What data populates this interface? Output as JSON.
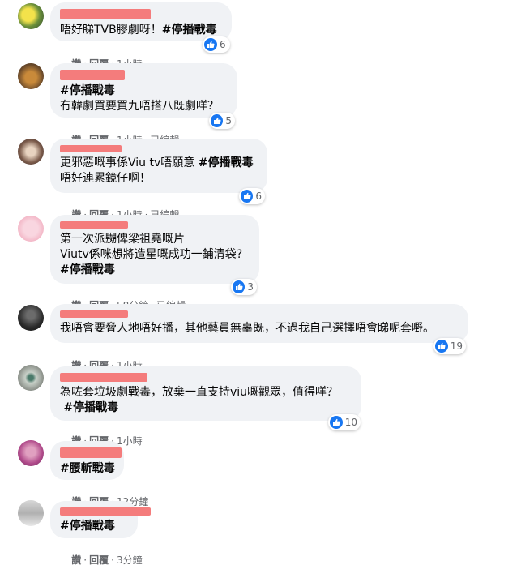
{
  "comments": [
    {
      "lines": [
        [
          "唔好睇TVB膠劇呀！",
          "#停播戰毒"
        ]
      ],
      "likes": "6",
      "actions": {
        "read": "讚",
        "reply": "回覆",
        "time": "1小時",
        "edited": ""
      }
    },
    {
      "lines": [
        [
          "",
          "#停播戰毒"
        ],
        [
          "冇韓劇買要買九唔搭八既劇咩？",
          ""
        ]
      ],
      "likes": "5",
      "actions": {
        "read": "讚",
        "reply": "回覆",
        "time": "1小時",
        "edited": "已編輯"
      }
    },
    {
      "lines": [
        [
          "更邪惡嘅事係Viu tv唔願意 ",
          "#停播戰毒"
        ],
        [
          "唔好連累鏡仔啊！",
          ""
        ]
      ],
      "likes": "6",
      "actions": {
        "read": "讚",
        "reply": "回覆",
        "time": "1小時",
        "edited": "已編輯"
      }
    },
    {
      "lines": [
        [
          "第一次派嬲俾梁祖堯嘅片",
          ""
        ],
        [
          "Viutv係咪想將造星嘅成功一鋪清袋?",
          ""
        ],
        [
          "",
          "#停播戰毒"
        ]
      ],
      "likes": "3",
      "actions": {
        "read": "讚",
        "reply": "回覆",
        "time": "58分鐘",
        "edited": "已編輯"
      }
    },
    {
      "lines": [
        [
          "我唔會要脅人地唔好播，其他藝員無辜既，不過我自己選擇唔會睇呢套嘢。",
          ""
        ]
      ],
      "likes": "19",
      "actions": {
        "read": "讚",
        "reply": "回覆",
        "time": "1小時",
        "edited": ""
      }
    },
    {
      "lines": [
        [
          "為咗套垃圾劇戰毒，放棄一直支持viu嘅觀眾，值得咩？",
          ""
        ],
        [
          " ",
          "#停播戰毒"
        ]
      ],
      "likes": "10",
      "actions": {
        "read": "讚",
        "reply": "回覆",
        "time": "1小時",
        "edited": ""
      }
    },
    {
      "lines": [
        [
          "",
          "#腰斬戰毒"
        ]
      ],
      "likes": "",
      "actions": {
        "read": "讚",
        "reply": "回覆",
        "time": "12分鐘",
        "edited": ""
      }
    },
    {
      "lines": [
        [
          "",
          "#停播戰毒"
        ]
      ],
      "likes": "",
      "actions": {
        "read": "讚",
        "reply": "回覆",
        "time": "3分鐘",
        "edited": ""
      }
    }
  ],
  "colors": {
    "bubble": "#f0f2f5",
    "redaction": "#f47c7c",
    "like": "#1877f2",
    "meta": "#65676b"
  },
  "icons": {
    "reaction": "thumbs-up-icon"
  }
}
